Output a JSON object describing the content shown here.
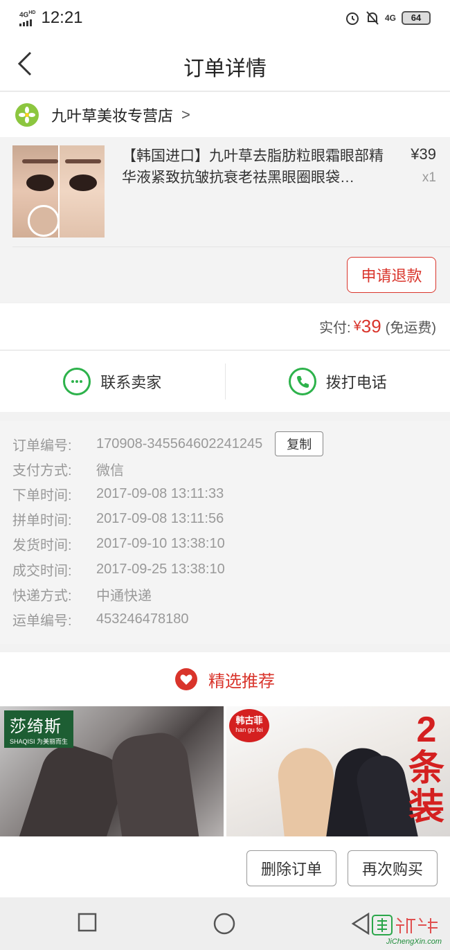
{
  "status_bar": {
    "network": "4G",
    "network_sup": "HD",
    "time": "12:21",
    "signal_4g": "4G",
    "battery": "64"
  },
  "nav": {
    "title": "订单详情"
  },
  "store": {
    "name": "九叶草美妆专营店",
    "arrow": ">"
  },
  "product": {
    "title": "【韩国进口】九叶草去脂肪粒眼霜眼部精华液紧致抗皱抗衰老祛黑眼圈眼袋…",
    "price": "¥39",
    "quantity": "x1",
    "refund_button": "申请退款"
  },
  "payment": {
    "label": "实付:",
    "currency": "¥",
    "amount": "39",
    "shipping_note": "(免运费)"
  },
  "contact": {
    "seller_label": "联系卖家",
    "phone_label": "拨打电话"
  },
  "order_info": {
    "rows": [
      {
        "label": "订单编号:",
        "value": "170908-345564602241245"
      },
      {
        "label": "支付方式:",
        "value": "微信"
      },
      {
        "label": "下单时间:",
        "value": "2017-09-08 13:11:33"
      },
      {
        "label": "拼单时间:",
        "value": "2017-09-08 13:11:56"
      },
      {
        "label": "发货时间:",
        "value": "2017-09-10 13:38:10"
      },
      {
        "label": "成交时间:",
        "value": "2017-09-25 13:38:10"
      },
      {
        "label": "快递方式:",
        "value": "中通快递"
      },
      {
        "label": "运单编号:",
        "value": "453246478180"
      }
    ],
    "copy_button": "复制"
  },
  "recommend": {
    "title": "精选推荐",
    "items": [
      {
        "brand_cn": "莎绮斯",
        "brand_en": "SHAQISI 为美丽而生"
      },
      {
        "brand_cn": "韩古菲",
        "brand_en": "han gu fei",
        "promo": "2条装"
      }
    ]
  },
  "actions": {
    "delete_label": "删除订单",
    "rebuy_label": "再次购买"
  },
  "watermark": {
    "text": "JiChengXin.com"
  },
  "colors": {
    "accent_red": "#d9342b",
    "wechat_green": "#2db24b"
  }
}
